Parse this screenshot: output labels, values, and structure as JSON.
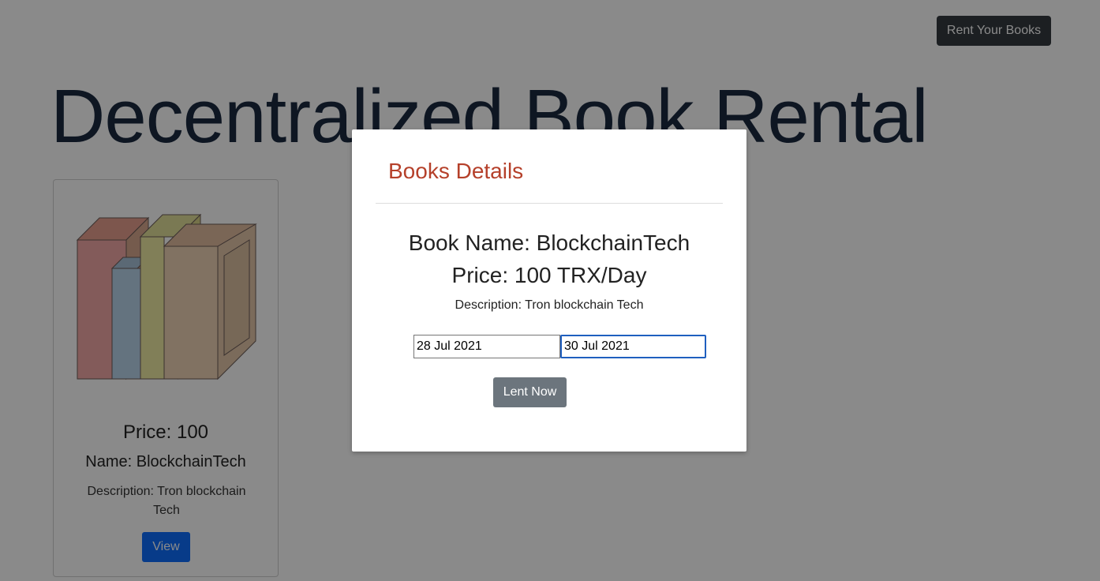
{
  "header": {
    "rent_button_label": "Rent Your Books"
  },
  "hero": {
    "title": "Decentralized Book Rental"
  },
  "card": {
    "price": "Price: 100",
    "name": "Name: BlockchainTech",
    "description": "Description: Tron blockchain Tech",
    "view_label": "View",
    "image": "books-illustration"
  },
  "modal": {
    "title": "Books Details",
    "book_name": "Book Name: BlockchainTech",
    "price": "Price: 100 TRX/Day",
    "description": "Description: Tron blockchain Tech",
    "start_date": "28 Jul 2021",
    "end_date": "30 Jul 2021",
    "lent_label": "Lent Now"
  },
  "colors": {
    "modal_title": "#b5402a",
    "primary_button": "#0d6efd",
    "dark_button": "#343a40",
    "secondary_button": "#6c757d"
  }
}
